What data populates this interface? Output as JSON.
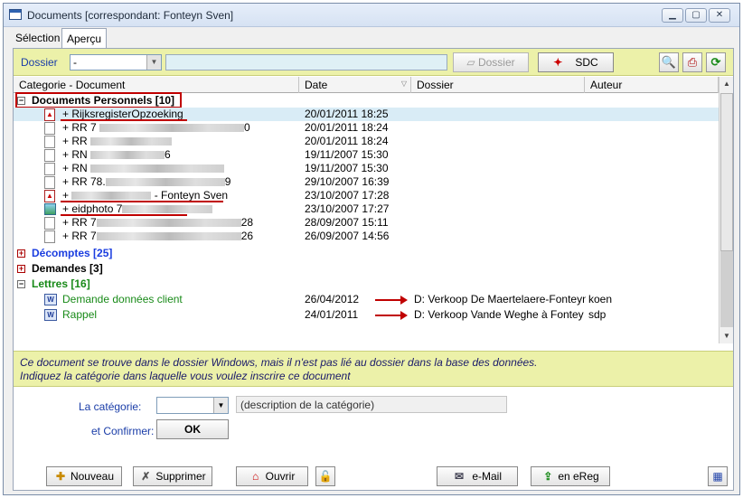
{
  "window": {
    "title": "Documents  [correspondant: Fonteyn Sven]",
    "controls": {
      "minimize": "▭",
      "maximize": "▭",
      "close": "✕"
    }
  },
  "tabs": [
    "Sélection",
    "Aperçu"
  ],
  "toolbar": {
    "dossier_label": "Dossier",
    "dossier_value": "-",
    "dossier_button": "Dossier",
    "sdc_button": "SDC"
  },
  "grid": {
    "columns": [
      "Categorie - Document",
      "Date",
      "Dossier",
      "Auteur"
    ],
    "groups": [
      {
        "label": "Documents Personnels [10]",
        "color": "#000000",
        "expanded": true
      },
      {
        "label": "Décomptes [25]",
        "color": "#1a3de0",
        "expanded": false
      },
      {
        "label": "Demandes [3]",
        "color": "#000000",
        "expanded": false
      },
      {
        "label": "Lettres [16]",
        "color": "#188a18",
        "expanded": true
      }
    ],
    "personal_docs": [
      {
        "name": "+ RijksregisterOpzoeking",
        "date": "20/01/2011 18:25",
        "icon": "pdf-icon",
        "selected": true
      },
      {
        "name": "+ RR 7",
        "suffix": "0",
        "date": "20/01/2011 18:24",
        "icon": "doc-icon"
      },
      {
        "name": "+ RR",
        "suffix": "",
        "date": "20/01/2011 18:24",
        "icon": "doc-icon"
      },
      {
        "name": "+ RN",
        "suffix": "6",
        "date": "19/11/2007 15:30",
        "icon": "doc-icon"
      },
      {
        "name": "+ RN",
        "suffix": "",
        "date": "19/11/2007 15:30",
        "icon": "doc-icon"
      },
      {
        "name": "+ RR 78.",
        "suffix": "9",
        "date": "29/10/2007 16:39",
        "icon": "doc-icon"
      },
      {
        "name": "+",
        "suffix": "- Fonteyn Sven",
        "date": "23/10/2007 17:28",
        "icon": "pdf-icon"
      },
      {
        "name": "+ eidphoto 7",
        "suffix": "",
        "date": "23/10/2007 17:27",
        "icon": "image-icon"
      },
      {
        "name": "+ RR 7",
        "suffix": "28",
        "date": "28/09/2007 15:11",
        "icon": "doc-icon"
      },
      {
        "name": "+ RR 7",
        "suffix": "26",
        "date": "26/09/2007 14:56",
        "icon": "doc-icon"
      }
    ],
    "letters": [
      {
        "name": "Demande données client",
        "date": "26/04/2012",
        "dossier": "D: Verkoop De Maertelaere-Fonteyn",
        "author": "koen"
      },
      {
        "name": "Rappel",
        "date": "24/01/2011",
        "dossier": "D: Verkoop Vande Weghe à Fontey",
        "author": "sdp"
      }
    ]
  },
  "message": {
    "line1": "Ce document se trouve dans le dossier Windows, mais il n'est pas lié au dossier dans la base des données.",
    "line2": "Indiquez la catégorie dans laquelle vous voulez inscrire ce document"
  },
  "form": {
    "category_label": "La catégorie:",
    "category_desc": "(description de la catégorie)",
    "confirm_label": "et Confirmer:",
    "ok_button": "OK"
  },
  "bottom_buttons": {
    "new": "Nouveau",
    "delete": "Supprimer",
    "open": "Ouvrir",
    "email": "e-Mail",
    "ereg": "en eReg"
  }
}
